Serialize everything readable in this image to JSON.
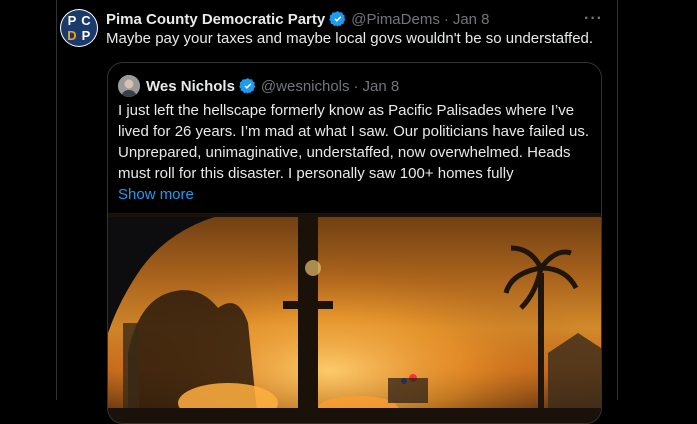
{
  "tweet": {
    "author_name": "Pima County Democratic Party",
    "author_handle": "@PimaDems",
    "separator": "·",
    "date": "Jan 8",
    "avatar_letters": [
      "PC",
      "DP"
    ],
    "text": "Maybe pay your taxes and maybe local govs wouldn't be so understaffed.",
    "more_label": "···"
  },
  "quote": {
    "author_name": "Wes Nichols",
    "author_handle": "@wesnichols",
    "separator": "·",
    "date": "Jan 8",
    "lines": [
      "I just left the hellscape formerly know as Pacific Palisades where I’ve",
      "lived for 26 years. I’m mad at what I saw. Our politicians have failed us.",
      "Unprepared, unimaginative, understaffed, now overwhelmed. Heads",
      "must roll for this disaster. I personally saw 100+ homes fully"
    ],
    "show_more": "Show more"
  },
  "colors": {
    "background": "#000000",
    "text": "#e7e9ea",
    "muted": "#71767b",
    "link": "#1d9bf0",
    "verified": "#1d9bf0",
    "border": "#2f3336"
  },
  "icons": {
    "verified": "verified-badge-icon",
    "more": "more-horizontal-icon"
  }
}
